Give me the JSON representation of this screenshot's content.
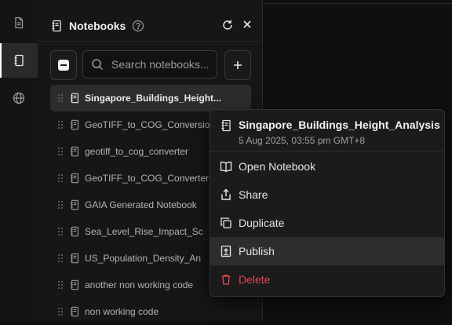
{
  "panel": {
    "title": "Notebooks",
    "search_placeholder": "Search notebooks..."
  },
  "notebooks": [
    {
      "label": "Singapore_Buildings_Height...",
      "selected": true
    },
    {
      "label": "GeoTIFF_to_COG_Conversion"
    },
    {
      "label": "geotiff_to_cog_converter"
    },
    {
      "label": "GeoTIFF_to_COG_Converter"
    },
    {
      "label": "GAIA Generated Notebook"
    },
    {
      "label": "Sea_Level_Rise_Impact_Sc"
    },
    {
      "label": "US_Population_Density_An"
    },
    {
      "label": "another non working code"
    },
    {
      "label": "non working code"
    }
  ],
  "context_menu": {
    "title": "Singapore_Buildings_Height_Analysis",
    "date": "5 Aug 2025, 03:55 pm GMT+8",
    "items": [
      {
        "label": "Open Notebook",
        "icon": "book-open-icon"
      },
      {
        "label": "Share",
        "icon": "share-icon"
      },
      {
        "label": "Duplicate",
        "icon": "duplicate-icon"
      },
      {
        "label": "Publish",
        "icon": "publish-icon"
      },
      {
        "label": "Delete",
        "icon": "trash-icon",
        "color": "#e5484d"
      }
    ]
  },
  "rail": {
    "items": [
      {
        "icon": "file-icon"
      },
      {
        "icon": "notebook-icon",
        "active": true
      },
      {
        "icon": "globe-icon"
      }
    ]
  }
}
